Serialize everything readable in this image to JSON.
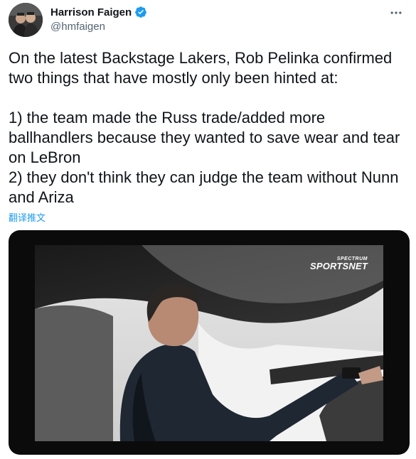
{
  "author": {
    "name": "Harrison Faigen",
    "handle": "@hmfaigen",
    "avatar_icon": "avatar-photo",
    "verified_icon": "verified-badge-icon"
  },
  "tweet": {
    "text": "On the latest Backstage Lakers, Rob Pelinka confirmed two things that have mostly only been hinted at:\n\n1) the team made the Russ trade/added more ballhandlers because they wanted to save wear and tear on LeBron\n2) they don't think they can judge the team without Nunn and Ariza",
    "translate_label": "翻译推文"
  },
  "media": {
    "watermark_top": "SPECTRUM",
    "watermark_main": "SPORTSNET"
  },
  "colors": {
    "accent": "#1d9bf0",
    "text_primary": "#0f1419",
    "text_secondary": "#536471"
  }
}
